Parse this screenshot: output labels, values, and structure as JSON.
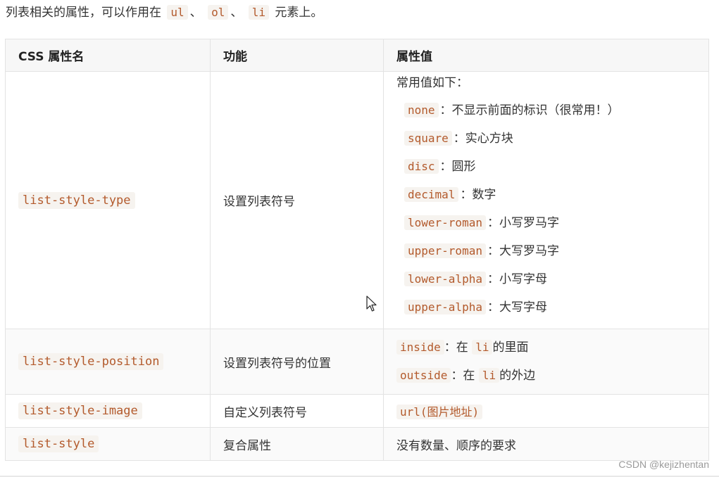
{
  "intro": {
    "prefix": "列表相关的属性，可以作用在",
    "tag_ul": "ul",
    "sep1": "、",
    "tag_ol": "ol",
    "sep2": "、",
    "tag_li": "li",
    "suffix": "元素上。"
  },
  "table": {
    "headers": [
      "CSS 属性名",
      "功能",
      "属性值"
    ],
    "rows": [
      {
        "property": "list-style-type",
        "function": "设置列表符号",
        "values_title": "常用值如下：",
        "values": [
          {
            "code": "none",
            "desc": "：不显示前面的标识（很常用！）"
          },
          {
            "code": "square",
            "desc": "：实心方块"
          },
          {
            "code": "disc",
            "desc": "：圆形"
          },
          {
            "code": "decimal",
            "desc": "：数字"
          },
          {
            "code": "lower-roman",
            "desc": "：小写罗马字"
          },
          {
            "code": "upper-roman",
            "desc": "：大写罗马字"
          },
          {
            "code": "lower-alpha",
            "desc": "：小写字母"
          },
          {
            "code": "upper-alpha",
            "desc": "：大写字母"
          }
        ]
      },
      {
        "property": "list-style-position",
        "function": "设置列表符号的位置",
        "values": [
          {
            "code": "inside",
            "mid": "：在",
            "tag": "li",
            "desc": "的里面"
          },
          {
            "code": "outside",
            "mid": "：在",
            "tag": "li",
            "desc": "的外边"
          }
        ]
      },
      {
        "property": "list-style-image",
        "function": "自定义列表符号",
        "value_code": "url(",
        "value_note": "图片地址",
        "value_close": ")"
      },
      {
        "property": "list-style",
        "function": "复合属性",
        "value_text": "没有数量、顺序的要求"
      }
    ]
  },
  "watermark": "CSDN @kejizhentan",
  "colors": {
    "code_text": "#b35a2c",
    "code_bg": "#f6f3ef",
    "header_bg": "#f7f7f7",
    "border": "#e3e3e3"
  },
  "icons": {
    "cursor": "mouse-pointer-icon"
  }
}
